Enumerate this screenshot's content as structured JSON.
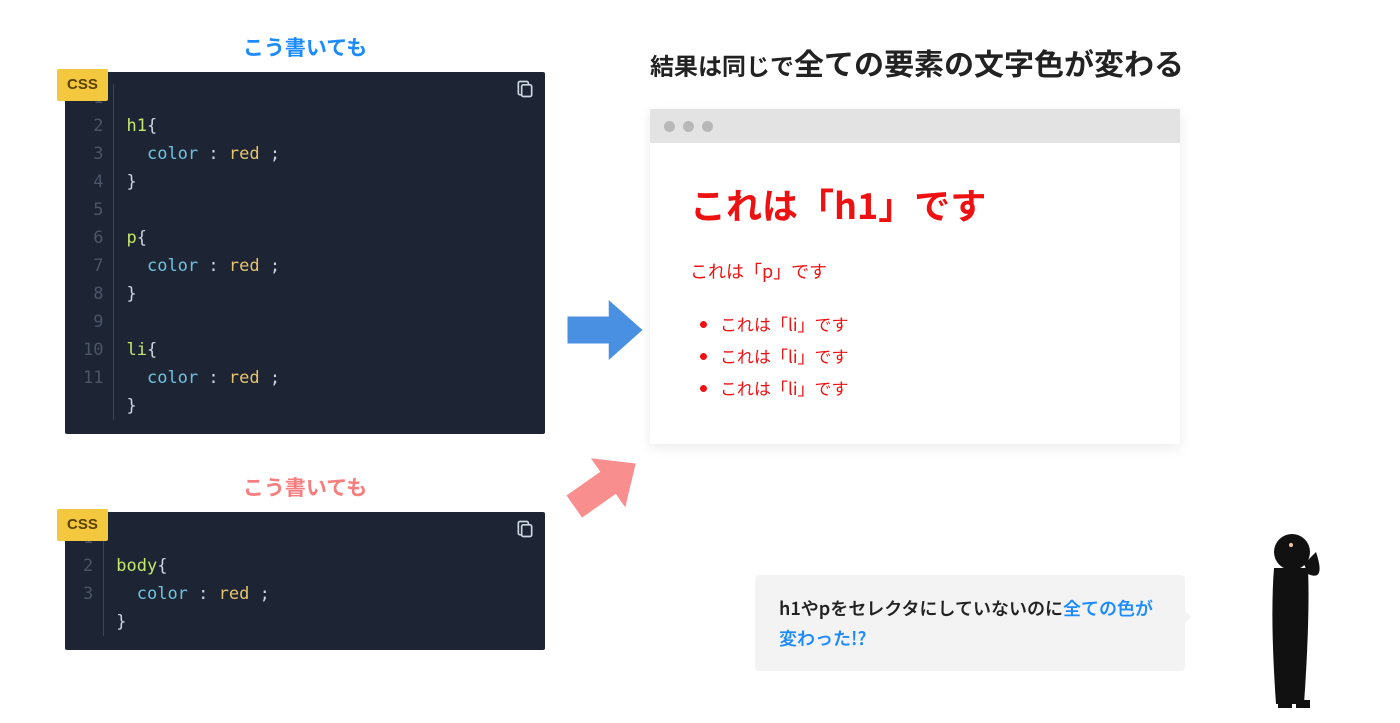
{
  "left": {
    "label1": "こう書いても",
    "label2": "こう書いても",
    "editor_tag": "CSS"
  },
  "code1": {
    "lines": [
      "1",
      "2",
      "3",
      "4",
      "5",
      "6",
      "7",
      "8",
      "9",
      "10",
      "11"
    ],
    "l1_sel": "h1",
    "l1_brace": "{",
    "l2_prop": "color",
    "l2_colon": " : ",
    "l2_val": "red",
    "l2_semi": " ;",
    "l3_brace": "}",
    "l5_sel": "p",
    "l5_brace": "{",
    "l6_prop": "color",
    "l6_colon": " : ",
    "l6_val": "red",
    "l6_semi": " ;",
    "l7_brace": "}",
    "l9_sel": "li",
    "l9_brace": "{",
    "l10_prop": "color",
    "l10_colon": " : ",
    "l10_val": "red",
    "l10_semi": " ;",
    "l11_brace": "}"
  },
  "code2": {
    "lines": [
      "1",
      "2",
      "3"
    ],
    "l1_sel": "body",
    "l1_brace": "{",
    "l2_prop": "color",
    "l2_colon": " : ",
    "l2_val": "red",
    "l2_semi": " ;",
    "l3_brace": "}"
  },
  "right": {
    "title_plain": "結果は同じで",
    "title_em": "全ての要素の文字色が変わる",
    "h1": "これは「h1」です",
    "p": "これは「p」です",
    "li": "これは「li」です"
  },
  "speech": {
    "t1": "h1やpをセレクタにしていないのに",
    "hl": "全ての色が変わった!?"
  }
}
